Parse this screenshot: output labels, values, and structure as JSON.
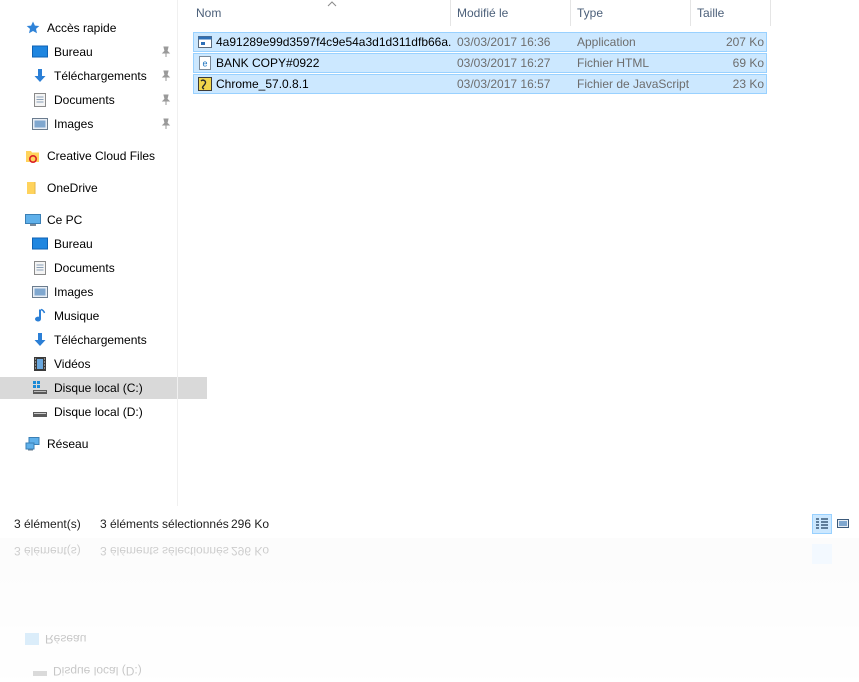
{
  "sidebar": {
    "quick_access": {
      "label": "Accès rapide",
      "items": [
        {
          "label": "Bureau",
          "icon": "desktop-icon",
          "pinned": true
        },
        {
          "label": "Téléchargements",
          "icon": "download-icon",
          "pinned": true
        },
        {
          "label": "Documents",
          "icon": "documents-icon",
          "pinned": true
        },
        {
          "label": "Images",
          "icon": "images-icon",
          "pinned": true
        }
      ]
    },
    "creative_cloud": {
      "label": "Creative Cloud Files"
    },
    "onedrive": {
      "label": "OneDrive"
    },
    "this_pc": {
      "label": "Ce PC",
      "items": [
        {
          "label": "Bureau",
          "icon": "desktop-icon"
        },
        {
          "label": "Documents",
          "icon": "documents-icon"
        },
        {
          "label": "Images",
          "icon": "images-icon"
        },
        {
          "label": "Musique",
          "icon": "music-icon"
        },
        {
          "label": "Téléchargements",
          "icon": "download-icon"
        },
        {
          "label": "Vidéos",
          "icon": "videos-icon"
        },
        {
          "label": "Disque local (C:)",
          "icon": "drive-c-icon",
          "selected": true
        },
        {
          "label": "Disque local (D:)",
          "icon": "drive-d-icon"
        }
      ]
    },
    "network": {
      "label": "Réseau"
    }
  },
  "columns": {
    "name": "Nom",
    "modified": "Modifié le",
    "type": "Type",
    "size": "Taille"
  },
  "files": [
    {
      "name": "4a91289e99d3597f4c9e54a3d1d311dfb66a...",
      "modified": "03/03/2017 16:36",
      "type": "Application",
      "size": "207 Ko",
      "icon": "application-icon"
    },
    {
      "name": "BANK COPY#0922",
      "modified": "03/03/2017 16:27",
      "type": "Fichier HTML",
      "size": "69 Ko",
      "icon": "html-file-icon"
    },
    {
      "name": "Chrome_57.0.8.1",
      "modified": "03/03/2017 16:57",
      "type": "Fichier de JavaScript",
      "size": "23 Ko",
      "icon": "javascript-file-icon"
    }
  ],
  "status": {
    "count": "3 élément(s)",
    "selected": "3 éléments sélectionnés",
    "selected_size": "296 Ko"
  },
  "colors": {
    "selection_bg": "#cce8ff",
    "selection_border": "#99d1ff",
    "header_text": "#4c607a",
    "nav_selected": "#d9d9d9"
  }
}
